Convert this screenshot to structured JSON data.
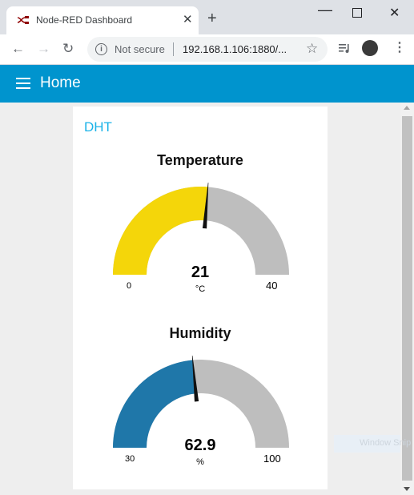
{
  "browser": {
    "tab_title": "Node-RED Dashboard",
    "tab_close": "✕",
    "new_tab": "+",
    "security_label": "Not secure",
    "url": "192.168.1.106:1880/...",
    "window_min": "—",
    "window_close": "✕"
  },
  "header": {
    "title": "Home"
  },
  "group": {
    "title": "DHT"
  },
  "gauges": [
    {
      "title": "Temperature",
      "value": 21,
      "value_text": "21",
      "unit": "°C",
      "min": 0,
      "max": 40,
      "min_label": "0",
      "max_label": "40",
      "fill_color": "#f4d60a",
      "track_color": "#bebebe"
    },
    {
      "title": "Humidity",
      "value": 62.9,
      "value_text": "62.9",
      "unit": "%",
      "min": 30,
      "max": 100,
      "min_label": "30",
      "max_label": "100",
      "fill_color": "#1f77a9",
      "track_color": "#bebebe"
    }
  ],
  "overlay": {
    "text": "Window Snip"
  },
  "colors": {
    "header": "#0094ce",
    "group_title": "#1bb3e8"
  }
}
